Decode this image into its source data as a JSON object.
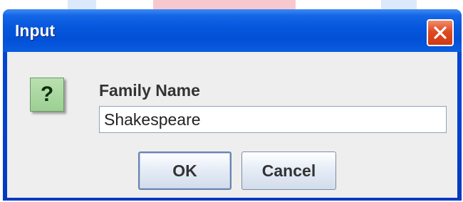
{
  "window": {
    "title": "Input",
    "close_icon": "close-icon"
  },
  "dialog": {
    "icon": "question-icon",
    "icon_glyph": "?",
    "label": "Family Name",
    "input_value": "Shakespeare",
    "buttons": {
      "ok_label": "OK",
      "cancel_label": "Cancel"
    }
  },
  "colors": {
    "titlebar": "#0250d6",
    "close_button": "#df4a22",
    "icon_bg": "#9ccf94",
    "content_bg": "#eeeeee"
  }
}
